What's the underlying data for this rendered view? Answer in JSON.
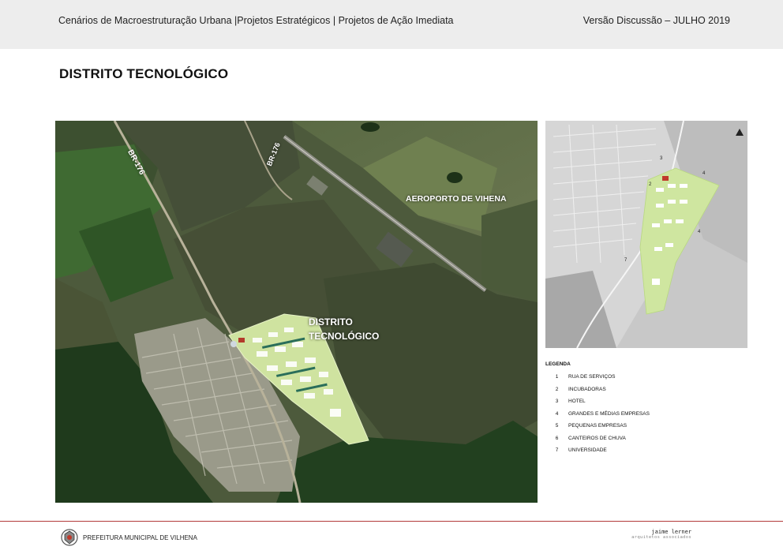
{
  "header": {
    "left_text": "Cenários de Macroestruturação Urbana |Projetos Estratégicos | Projetos de Ação Imediata",
    "right_text": "Versão Discussão – JULHO 2019"
  },
  "page_title": "DISTRITO TECNOLÓGICO",
  "main_map": {
    "labels": {
      "road_1": "BR-176",
      "road_2": "BR-176",
      "airport": "AEROPORTO DE VIHENA",
      "district_line1": "DISTRITO",
      "district_line2": "TECNOLÓGICO"
    }
  },
  "side_map": {
    "numbers": [
      "3",
      "4",
      "2",
      "4",
      "7"
    ]
  },
  "legend": {
    "title": "LEGENDA",
    "items": [
      {
        "num": "1",
        "label": "RUA DE SERVIÇOS"
      },
      {
        "num": "2",
        "label": "INCUBADORAS"
      },
      {
        "num": "3",
        "label": "HOTEL"
      },
      {
        "num": "4",
        "label": "GRANDES E MÉDIAS EMPRESAS"
      },
      {
        "num": "5",
        "label": "PEQUENAS EMPRESAS"
      },
      {
        "num": "6",
        "label": "CANTEIROS DE CHUVA"
      },
      {
        "num": "7",
        "label": "UNIVERSIDADE"
      }
    ]
  },
  "footer": {
    "left_text": "PREFEITURA MUNICIPAL DE VILHENA",
    "right_line1": "jaime lerner",
    "right_line2": "arquitetos associados"
  }
}
